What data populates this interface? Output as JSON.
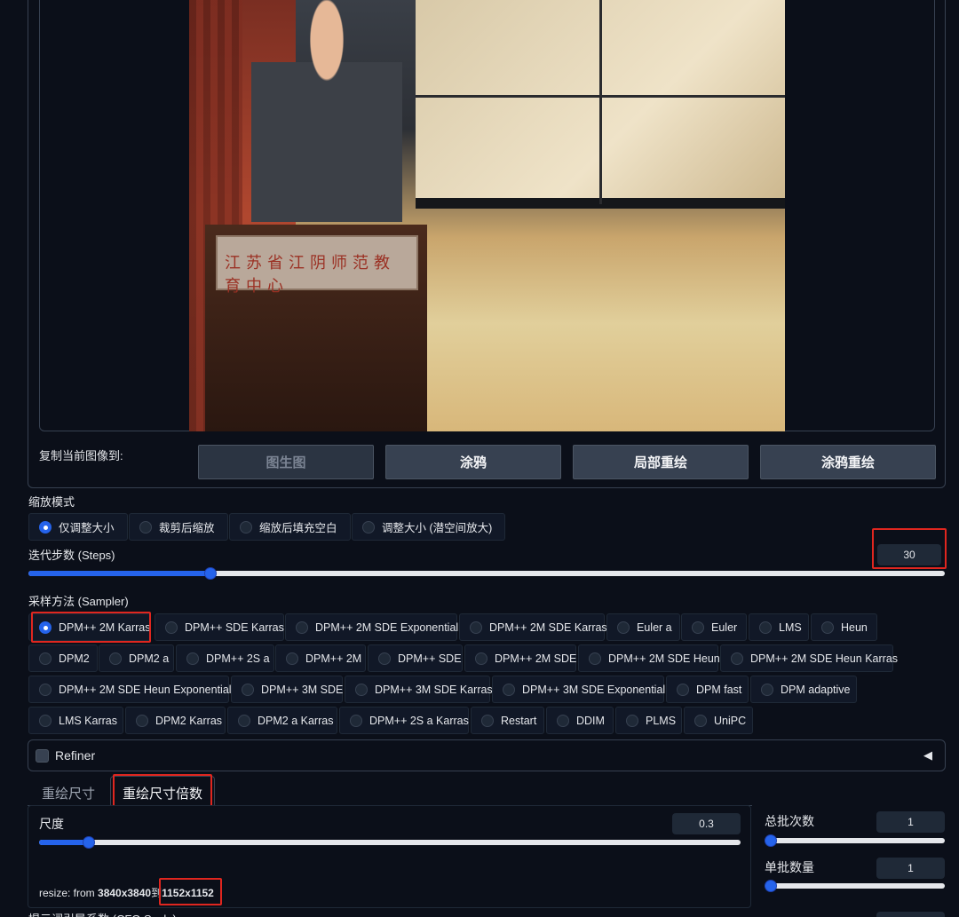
{
  "copy_to": {
    "label": "复制当前图像到:",
    "buttons": [
      "图生图",
      "涂鸦",
      "局部重绘",
      "涂鸦重绘"
    ]
  },
  "resize_mode": {
    "label": "缩放模式",
    "options": [
      "仅调整大小",
      "裁剪后缩放",
      "缩放后填充空白",
      "调整大小 (潜空间放大)"
    ],
    "selected": "仅调整大小"
  },
  "steps": {
    "label": "迭代步数 (Steps)",
    "value": "30",
    "fraction": 0.2
  },
  "sampler": {
    "label": "采样方法 (Sampler)",
    "selected": "DPM++ 2M Karras",
    "rows": [
      [
        "DPM++ 2M Karras",
        "DPM++ SDE Karras",
        "DPM++ 2M SDE Exponential",
        "DPM++ 2M SDE Karras",
        "Euler a",
        "Euler",
        "LMS",
        "Heun"
      ],
      [
        "DPM2",
        "DPM2 a",
        "DPM++ 2S a",
        "DPM++ 2M",
        "DPM++ SDE",
        "DPM++ 2M SDE",
        "DPM++ 2M SDE Heun",
        "DPM++ 2M SDE Heun Karras"
      ],
      [
        "DPM++ 2M SDE Heun Exponential",
        "DPM++ 3M SDE",
        "DPM++ 3M SDE Karras",
        "DPM++ 3M SDE Exponential",
        "DPM fast",
        "DPM adaptive"
      ],
      [
        "LMS Karras",
        "DPM2 Karras",
        "DPM2 a Karras",
        "DPM++ 2S a Karras",
        "Restart",
        "DDIM",
        "PLMS",
        "UniPC"
      ]
    ]
  },
  "refiner": {
    "label": "Refiner",
    "toggle_icon": "◀"
  },
  "tabs": [
    "重绘尺寸",
    "重绘尺寸倍数"
  ],
  "scale": {
    "label": "尺度",
    "value": "0.3",
    "fraction": 0.07,
    "resize_prefix": "resize: from ",
    "resize_from": "3840x3840",
    "resize_to_word": "到",
    "resize_to": "1152x1152"
  },
  "batch_count": {
    "label": "总批次数",
    "value": "1"
  },
  "batch_size": {
    "label": "单批数量",
    "value": "1"
  },
  "cfg": {
    "label": "提示词引导系数 (CFG Scale)"
  },
  "photo_plaque_text": "江苏省江阴师范教育中心"
}
